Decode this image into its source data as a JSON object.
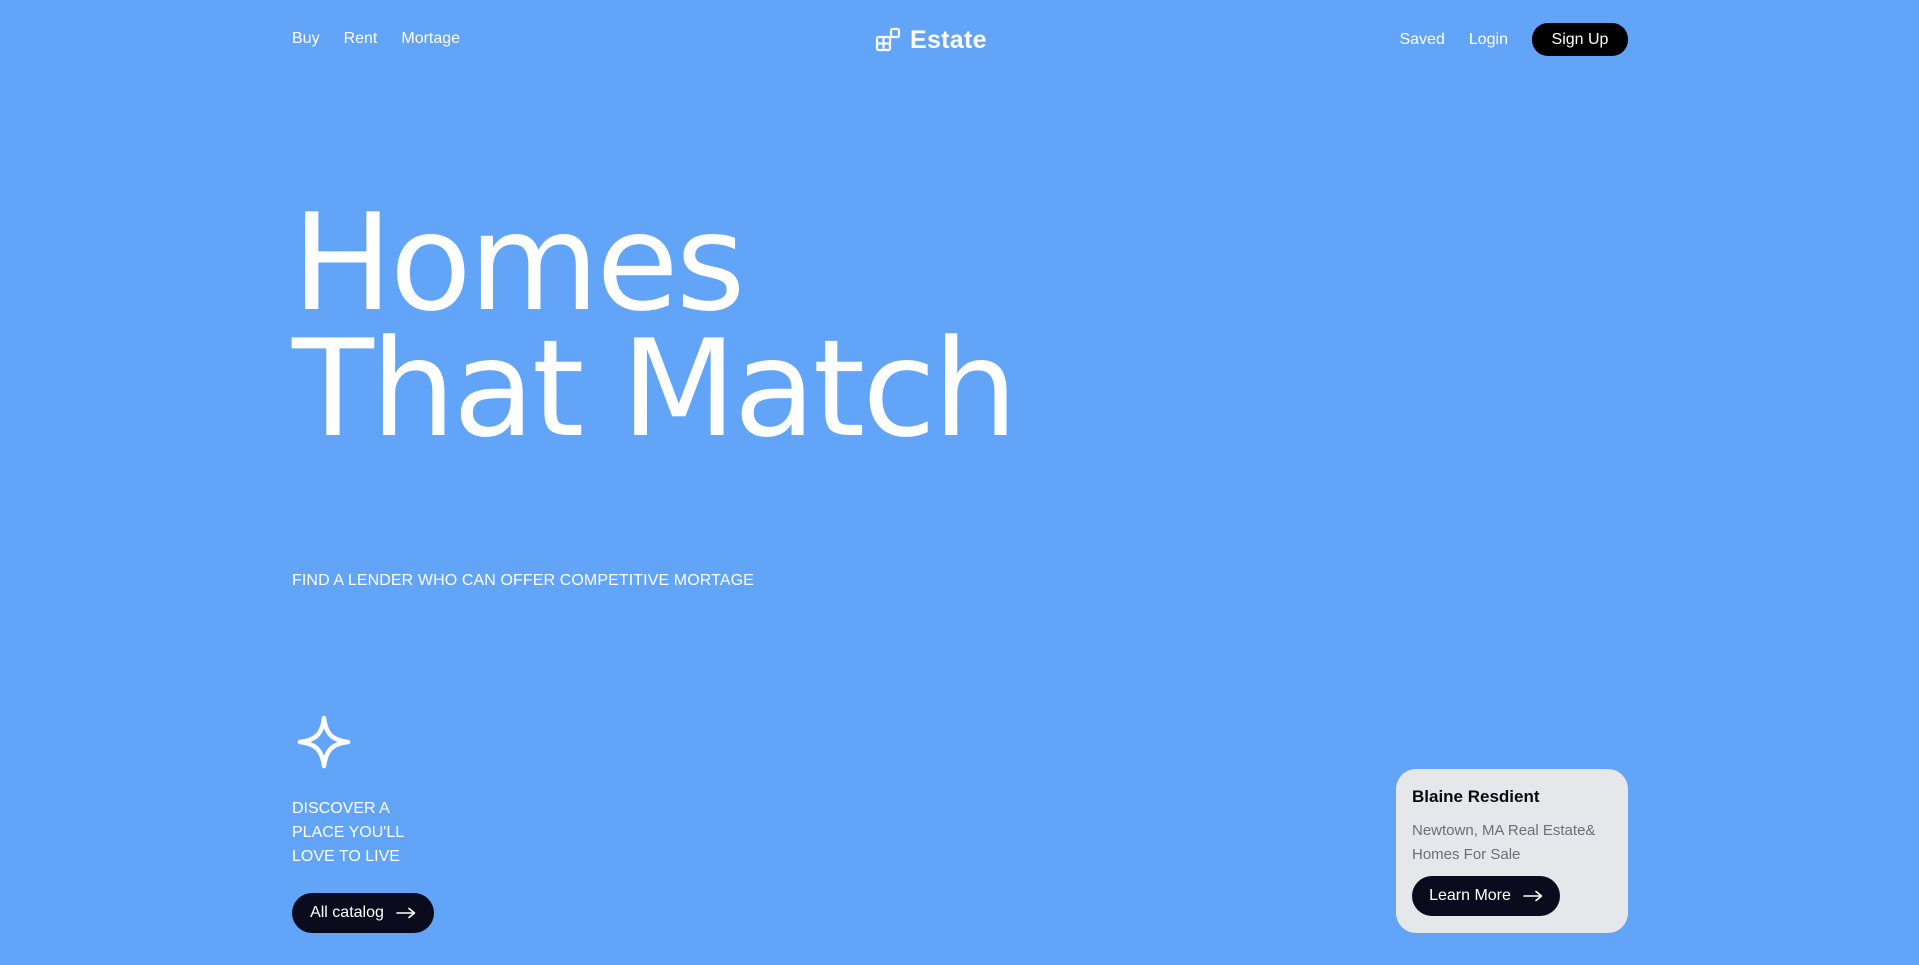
{
  "nav": {
    "left_links": [
      "Buy",
      "Rent",
      "Mortage"
    ],
    "logo_text": "Estate",
    "logo_icon": "blocks-icon",
    "saved_label": "Saved",
    "login_label": "Login",
    "signup_label": "Sign Up"
  },
  "hero": {
    "title_line1": "Homes",
    "title_line2": "That Match",
    "subtitle": "FIND A LENDER WHO CAN OFFER COMPETITIVE MORTAGE"
  },
  "discover": {
    "icon": "sparkle-icon",
    "lines": [
      "DISCOVER A",
      "PLACE YOU'LL",
      "LOVE TO LIVE"
    ],
    "button_label": "All catalog",
    "button_icon": "arrow-right-icon"
  },
  "card": {
    "title": "Blaine Resdient",
    "desc_line1": "Newtown, MA Real Estate&",
    "desc_line2": "Homes For Sale",
    "button_label": "Learn More",
    "button_icon": "arrow-right-icon"
  },
  "colors": {
    "background": "#62a5f8",
    "text": "#ffffff",
    "button_dark": "#0b0b1e",
    "card_bg": "#e6e7eb",
    "card_desc": "#6b6f78"
  }
}
